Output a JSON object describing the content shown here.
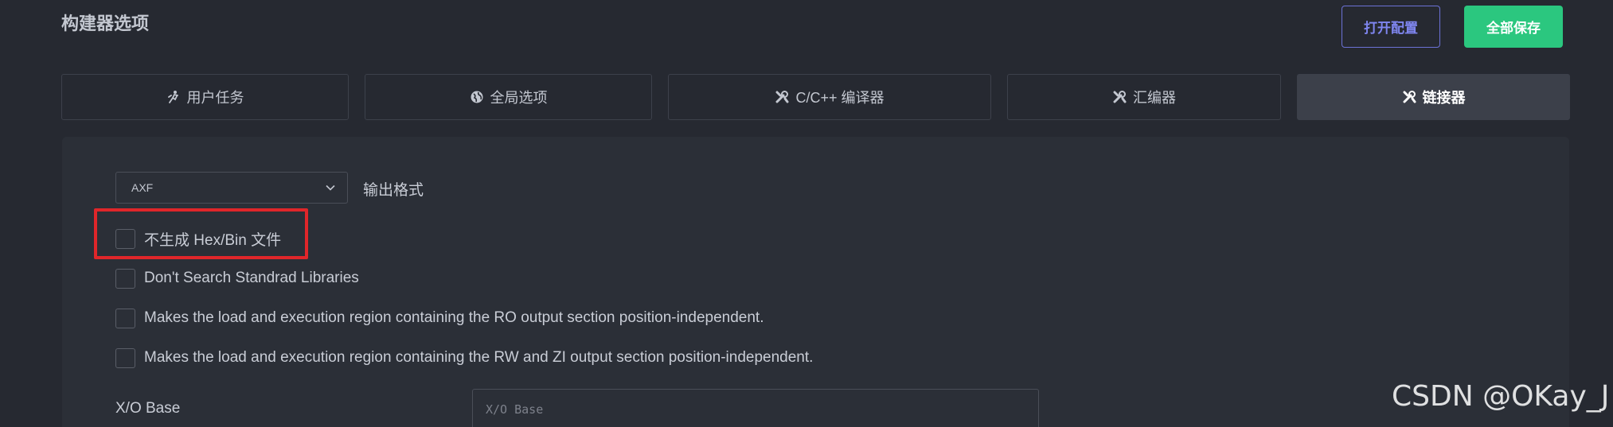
{
  "header": {
    "title": "构建器选项",
    "open_config_label": "打开配置",
    "save_all_label": "全部保存"
  },
  "tabs": [
    {
      "label": "用户任务",
      "icon": "user-task-icon",
      "active": false
    },
    {
      "label": "全局选项",
      "icon": "globe-icon",
      "active": false
    },
    {
      "label": "C/C++ 编译器",
      "icon": "tools-icon",
      "active": false
    },
    {
      "label": "汇编器",
      "icon": "tools-icon",
      "active": false
    },
    {
      "label": "链接器",
      "icon": "tools-icon",
      "active": true
    }
  ],
  "output_format": {
    "value": "AXF",
    "label": "输出格式"
  },
  "checkboxes": [
    {
      "label": "不生成 Hex/Bin 文件",
      "checked": false
    },
    {
      "label": "Don't Search Standrad Libraries",
      "checked": false
    },
    {
      "label": "Makes the load and execution region containing the RO output section position-independent.",
      "checked": false
    },
    {
      "label": "Makes the load and execution region containing the RW and ZI output section position-independent.",
      "checked": false
    }
  ],
  "xo_base": {
    "label": "X/O Base",
    "placeholder": "X/O Base",
    "value": ""
  },
  "watermark": "CSDN @OKay_J",
  "colors": {
    "background": "#262931",
    "panel": "#2b2f37",
    "active_tab": "#3c404a",
    "primary": "#2bc77f",
    "outline_button": "#6c72d6",
    "highlight": "#e0262a"
  }
}
